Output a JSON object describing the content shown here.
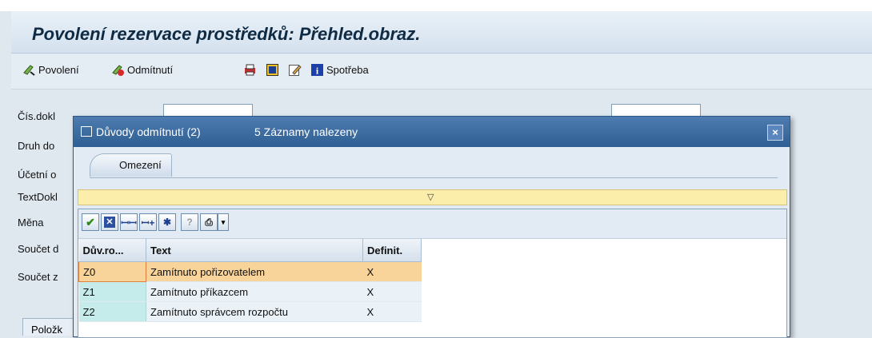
{
  "page": {
    "title": "Povolení rezervace prostředků: Přehled.obraz."
  },
  "toolbar": {
    "items": [
      {
        "label": "Povolení",
        "icon": "approve-icon"
      },
      {
        "label": "Odmítnutí",
        "icon": "reject-icon"
      },
      {
        "label": "",
        "icon": "print-icon"
      },
      {
        "label": "",
        "icon": "details-icon"
      },
      {
        "label": "",
        "icon": "edit-icon"
      },
      {
        "label": "Spotřeba",
        "icon": "info-icon"
      }
    ]
  },
  "form": {
    "labels": [
      "Čís.dokl",
      "Druh do",
      "Účetní o",
      "TextDokl",
      "Měna",
      "Součet d",
      "Součet z"
    ],
    "bottom_tab": "Položk"
  },
  "dialog": {
    "title": "Důvody odmítnutí (2)",
    "count": "5 Záznamy nalezeny",
    "close_label": "×",
    "tab": "Omezení",
    "columns": [
      "Dův.ro...",
      "Text",
      "Definit."
    ],
    "rows": [
      {
        "code": "Z0",
        "text": "Zamítnuto pořizovatelem",
        "def": "X"
      },
      {
        "code": "Z1",
        "text": "Zamítnuto příkazcem",
        "def": "X"
      },
      {
        "code": "Z2",
        "text": "Zamítnuto správcem rozpočtu",
        "def": "X"
      }
    ]
  },
  "colors": {
    "accent": "#2e5e93",
    "selected_row": "#f9d49a",
    "key_column": "#c5ecea"
  }
}
